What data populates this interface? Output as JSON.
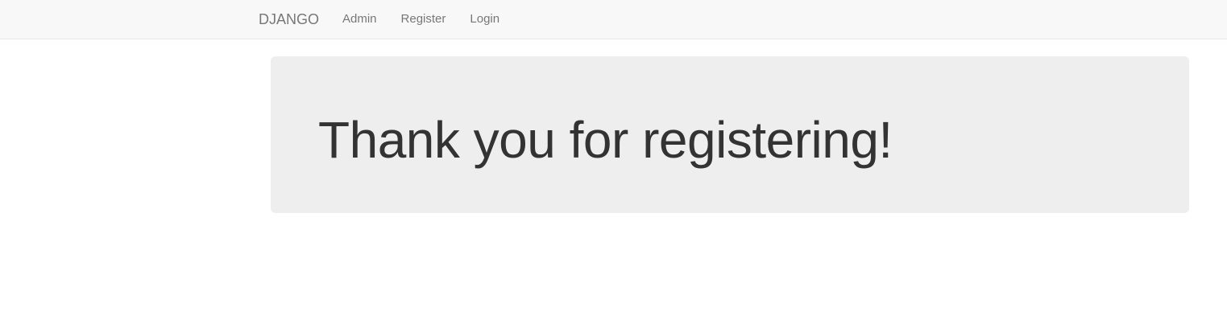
{
  "navbar": {
    "brand": "DJANGO",
    "links": [
      {
        "label": "Admin"
      },
      {
        "label": "Register"
      },
      {
        "label": "Login"
      }
    ]
  },
  "main": {
    "heading": "Thank you for registering!"
  },
  "colors": {
    "navbar_background": "#f8f8f8",
    "navbar_text": "#777777",
    "jumbotron_background": "#eeeeee",
    "heading_text": "#333333"
  }
}
